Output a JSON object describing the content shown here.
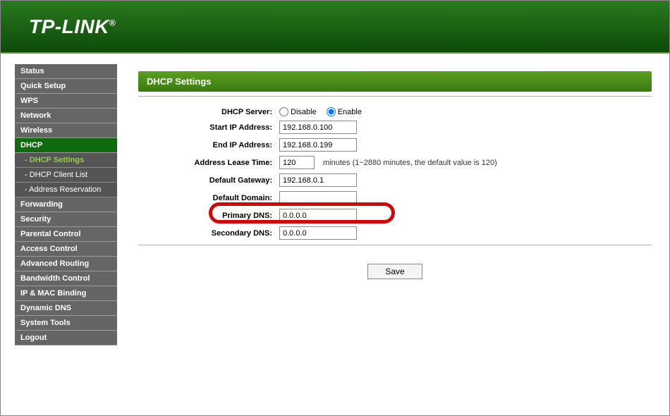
{
  "brand": "TP-LINK",
  "sidebar": {
    "items": [
      {
        "label": "Status"
      },
      {
        "label": "Quick Setup"
      },
      {
        "label": "WPS"
      },
      {
        "label": "Network"
      },
      {
        "label": "Wireless"
      },
      {
        "label": "DHCP",
        "active": true
      },
      {
        "label": "Forwarding"
      },
      {
        "label": "Security"
      },
      {
        "label": "Parental Control"
      },
      {
        "label": "Access Control"
      },
      {
        "label": "Advanced Routing"
      },
      {
        "label": "Bandwidth Control"
      },
      {
        "label": "IP & MAC Binding"
      },
      {
        "label": "Dynamic DNS"
      },
      {
        "label": "System Tools"
      },
      {
        "label": "Logout"
      }
    ],
    "subitems": [
      {
        "label": "- DHCP Settings",
        "active": true
      },
      {
        "label": "- DHCP Client List"
      },
      {
        "label": "- Address Reservation"
      }
    ]
  },
  "page": {
    "title": "DHCP Settings",
    "form": {
      "dhcp_server_label": "DHCP Server:",
      "disable_label": "Disable",
      "enable_label": "Enable",
      "dhcp_server_value": "enable",
      "start_ip_label": "Start IP Address:",
      "start_ip_value": "192.168.0.100",
      "end_ip_label": "End IP Address:",
      "end_ip_value": "192.168.0.199",
      "lease_label": "Address Lease Time:",
      "lease_value": "120",
      "lease_hint": "minutes (1~2880 minutes, the default value is 120)",
      "gateway_label": "Default Gateway:",
      "gateway_value": "192.168.0.1",
      "domain_label": "Default Domain:",
      "domain_value": "",
      "primary_dns_label": "Primary DNS:",
      "primary_dns_value": "0.0.0.0",
      "secondary_dns_label": "Secondary DNS:",
      "secondary_dns_value": "0.0.0.0"
    },
    "save_label": "Save"
  },
  "highlight_target": "primary-dns-row"
}
